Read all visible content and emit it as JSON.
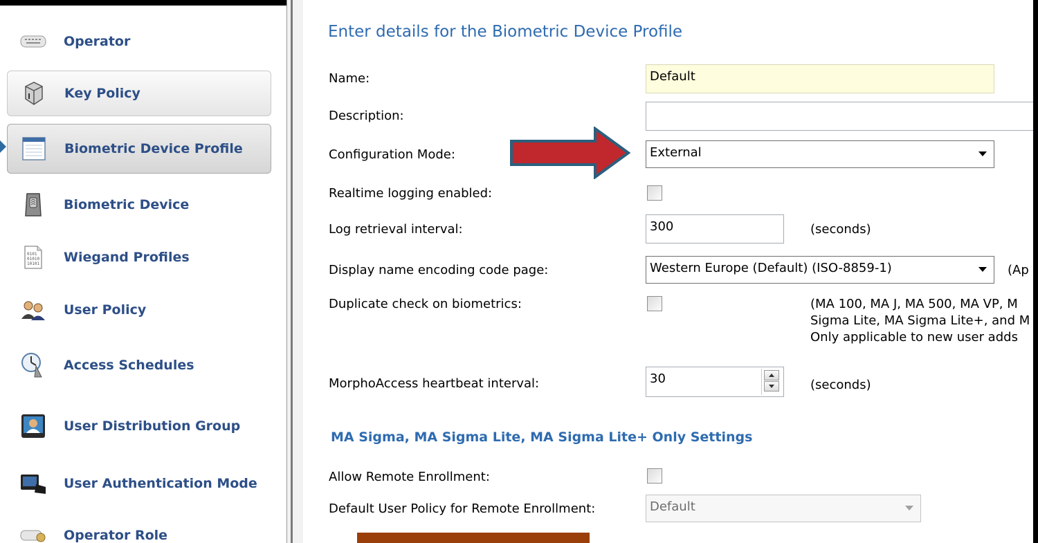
{
  "sidebar": {
    "items": [
      {
        "label": "Operator",
        "icon": "keyboard-icon"
      },
      {
        "label": "Key Policy",
        "icon": "key-policy-icon"
      },
      {
        "label": "Biometric Device Profile",
        "icon": "profile-window-icon"
      },
      {
        "label": "Biometric Device",
        "icon": "biometric-device-icon"
      },
      {
        "label": "Wiegand Profiles",
        "icon": "binary-document-icon"
      },
      {
        "label": "User Policy",
        "icon": "users-icon"
      },
      {
        "label": "Access Schedules",
        "icon": "schedule-clock-icon"
      },
      {
        "label": "User Distribution Group",
        "icon": "user-distribution-icon"
      },
      {
        "label": "User Authentication Mode",
        "icon": "authentication-icon"
      },
      {
        "label": "Operator Role",
        "icon": "operator-role-icon"
      }
    ],
    "active": "Biometric Device Profile"
  },
  "form": {
    "title": "Enter details for the Biometric Device Profile",
    "name_label": "Name:",
    "name_value": "Default",
    "description_label": "Description:",
    "description_value": "",
    "config_mode_label": "Configuration Mode:",
    "config_mode_value": "External",
    "realtime_logging_label": "Realtime logging enabled:",
    "realtime_logging_checked": false,
    "log_interval_label": "Log retrieval interval:",
    "log_interval_value": "300",
    "log_interval_unit": "(seconds)",
    "code_page_label": "Display name encoding code page:",
    "code_page_value": "Western Europe (Default) (ISO-8859-1)",
    "code_page_note": "(Ap",
    "duplicate_check_label": "Duplicate check on biometrics:",
    "duplicate_check_checked": false,
    "duplicate_note_line1": "(MA 100, MA J, MA 500, MA VP, M",
    "duplicate_note_line2": "Sigma Lite, MA Sigma Lite+, and M",
    "duplicate_note_line3": "Only applicable to new user adds",
    "heartbeat_label": "MorphoAccess heartbeat interval:",
    "heartbeat_value": "30",
    "heartbeat_unit": "(seconds)",
    "section_title": "MA Sigma, MA Sigma Lite, MA Sigma Lite+ Only Settings",
    "remote_enroll_label": "Allow Remote Enrollment:",
    "remote_enroll_checked": false,
    "default_policy_label": "Default User Policy for Remote Enrollment:",
    "default_policy_value": "Default"
  },
  "annotation": {
    "arrow_color": "#c0282d",
    "arrow_outline": "#2b5f7d",
    "bar_color": "#9a3f0a"
  }
}
